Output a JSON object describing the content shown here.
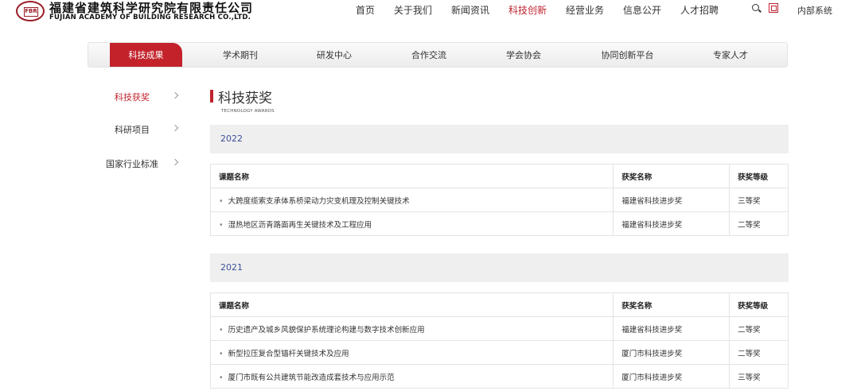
{
  "header": {
    "logo_cn": "福建省建筑科学研究院有限责任公司",
    "logo_en": "FUJIAN ACADEMY OF BUILDING RESEARCH CO.,LTD.",
    "logo_mark": "FBR",
    "nav": [
      {
        "label": "首页",
        "active": false
      },
      {
        "label": "关于我们",
        "active": false
      },
      {
        "label": "新闻资讯",
        "active": false
      },
      {
        "label": "科技创新",
        "active": true
      },
      {
        "label": "经营业务",
        "active": false
      },
      {
        "label": "信息公开",
        "active": false
      },
      {
        "label": "人才招聘",
        "active": false
      }
    ],
    "internal_system": "内部系统",
    "accent_color": "#c0242f"
  },
  "subnav": [
    {
      "label": "科技成果",
      "active": true
    },
    {
      "label": "学术期刊",
      "active": false
    },
    {
      "label": "研发中心",
      "active": false
    },
    {
      "label": "合作交流",
      "active": false
    },
    {
      "label": "学会协会",
      "active": false
    },
    {
      "label": "协同创新平台",
      "active": false
    },
    {
      "label": "专家人才",
      "active": false
    }
  ],
  "sidebar": [
    {
      "label": "科技获奖",
      "active": true
    },
    {
      "label": "科研项目",
      "active": false
    },
    {
      "label": "国家行业标准",
      "active": false
    }
  ],
  "main": {
    "title": "科技获奖",
    "subtitle": "TECHNOLOGY AWARDS",
    "columns": [
      "课题名称",
      "获奖名称",
      "获奖等级"
    ],
    "sections": [
      {
        "year": "2022",
        "rows": [
          {
            "name": "大跨度缆索支承体系桥梁动力灾变机理及控制关键技术",
            "award": "福建省科技进步奖",
            "level": "三等奖"
          },
          {
            "name": "湿热地区沥青路面再生关键技术及工程应用",
            "award": "福建省科技进步奖",
            "level": "二等奖"
          }
        ]
      },
      {
        "year": "2021",
        "rows": [
          {
            "name": "历史遗产及城乡风貌保护系统理论构建与数字技术创新应用",
            "award": "福建省科技进步奖",
            "level": "二等奖"
          },
          {
            "name": "新型拉压复合型锚杆关键技术及应用",
            "award": "厦门市科技进步奖",
            "level": "二等奖"
          },
          {
            "name": "厦门市既有公共建筑节能改造成套技术与应用示范",
            "award": "厦门市科技进步奖",
            "level": "三等奖"
          }
        ]
      }
    ]
  }
}
